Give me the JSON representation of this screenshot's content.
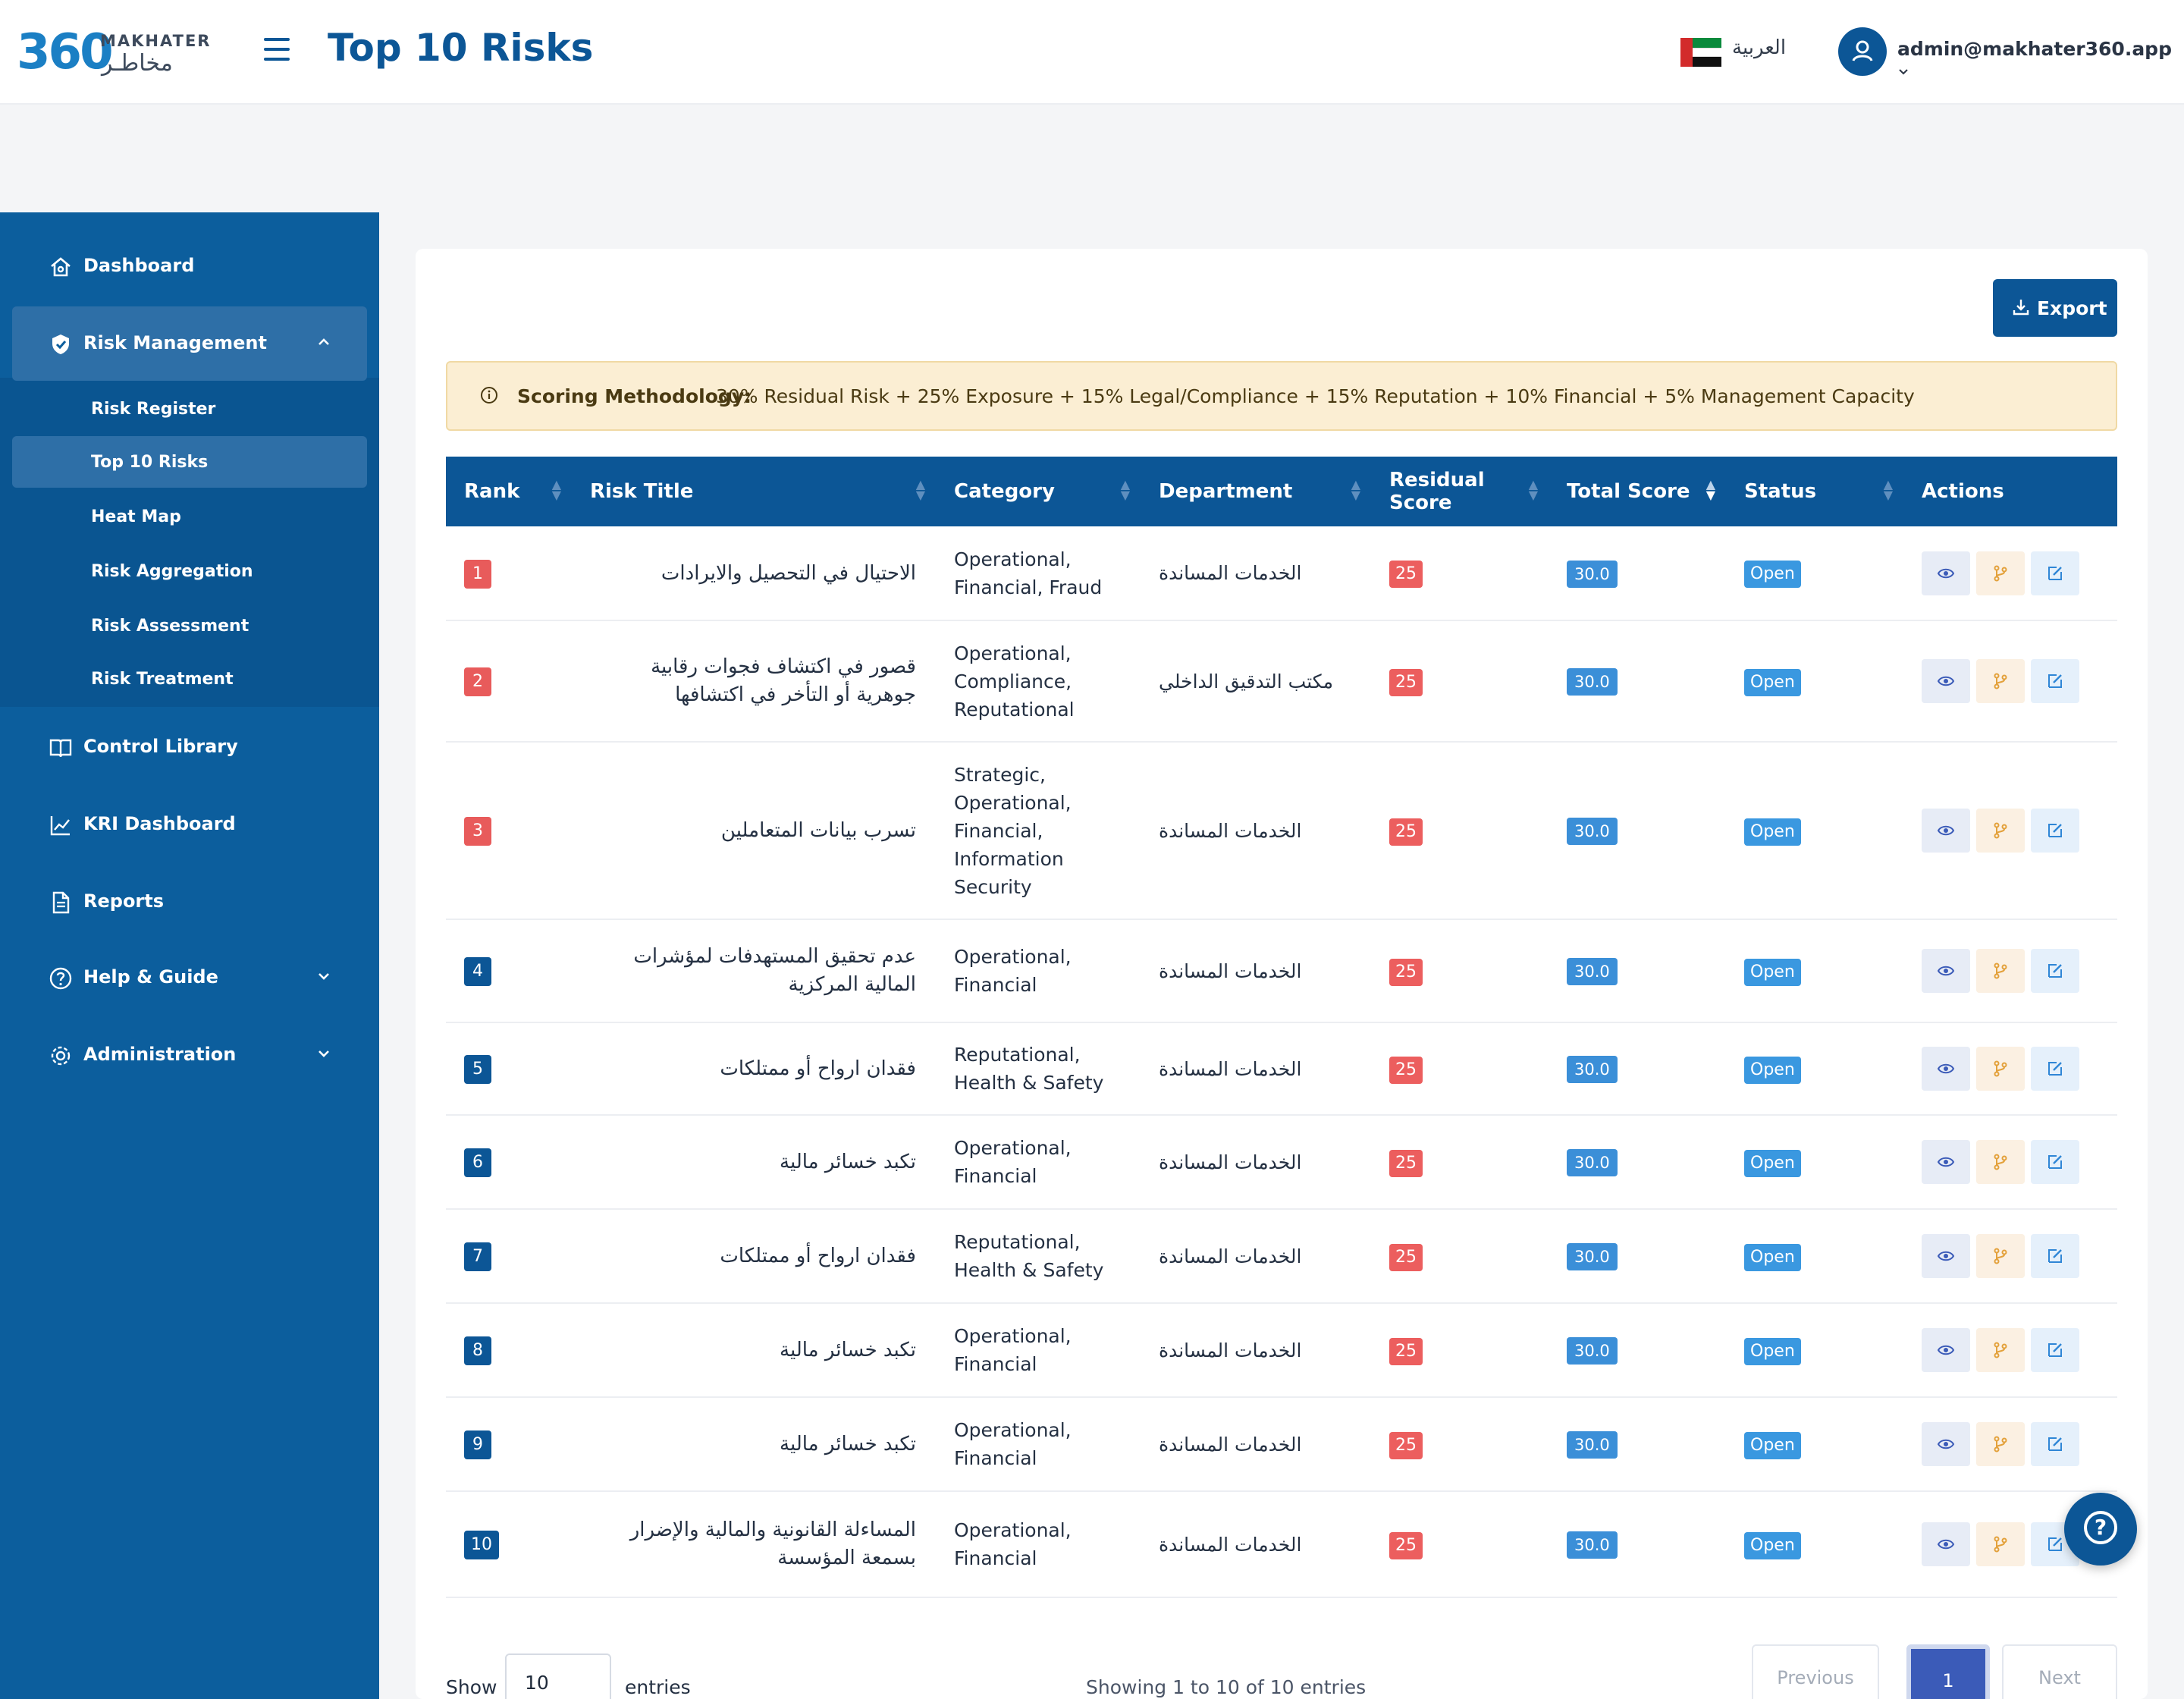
{
  "header": {
    "logo_number": "360",
    "logo_en": "MAKHATER",
    "logo_ar": "مخاطـر",
    "title": "Top 10 Risks",
    "language": "العربية",
    "user_email": "admin@makhater360.app"
  },
  "sidebar": {
    "items": [
      {
        "label": "Dashboard",
        "icon": "home-icon"
      },
      {
        "label": "Risk Management",
        "icon": "shield-icon",
        "expanded": true
      },
      {
        "label": "Control Library",
        "icon": "book-icon"
      },
      {
        "label": "KRI Dashboard",
        "icon": "chart-line-icon"
      },
      {
        "label": "Reports",
        "icon": "document-icon"
      },
      {
        "label": "Help & Guide",
        "icon": "help-circle-icon"
      },
      {
        "label": "Administration",
        "icon": "gear-icon"
      }
    ],
    "sub_items": [
      {
        "label": "Risk Register"
      },
      {
        "label": "Top 10 Risks",
        "active": true
      },
      {
        "label": "Heat Map"
      },
      {
        "label": "Risk Aggregation"
      },
      {
        "label": "Risk Assessment"
      },
      {
        "label": "Risk Treatment"
      }
    ]
  },
  "toolbar": {
    "export_label": "Export"
  },
  "notice": {
    "strong": "Scoring Methodology:",
    "text": "30% Residual Risk + 25% Exposure + 15% Legal/Compliance + 15% Reputation + 10% Financial + 5% Management Capacity"
  },
  "table": {
    "columns": [
      "Rank",
      "Risk Title",
      "Category",
      "Department",
      "Residual Score",
      "Total Score",
      "Status",
      "Actions"
    ],
    "rows": [
      {
        "rank": "1",
        "title": "الاحتيال في التحصيل والايرادات",
        "category": "Operational, Financial, Fraud",
        "department": "الخدمات المساندة",
        "residual": "25",
        "total": "30.0",
        "status": "Open"
      },
      {
        "rank": "2",
        "title": "قصور في اكتشاف فجوات رقابية جوهرية أو التأخر في اكتشافها",
        "category": "Operational, Compliance, Reputational",
        "department": "مكتب التدقيق الداخلي",
        "residual": "25",
        "total": "30.0",
        "status": "Open"
      },
      {
        "rank": "3",
        "title": "تسرب بيانات المتعاملين",
        "category": "Strategic, Operational, Financial, Information Security",
        "department": "الخدمات المساندة",
        "residual": "25",
        "total": "30.0",
        "status": "Open"
      },
      {
        "rank": "4",
        "title": "عدم تحقيق المستهدفات لمؤشرات المالية المركزية",
        "category": "Operational, Financial",
        "department": "الخدمات المساندة",
        "residual": "25",
        "total": "30.0",
        "status": "Open"
      },
      {
        "rank": "5",
        "title": "فقدان ارواح أو ممتلكات",
        "category": "Reputational, Health & Safety",
        "department": "الخدمات المساندة",
        "residual": "25",
        "total": "30.0",
        "status": "Open"
      },
      {
        "rank": "6",
        "title": "تكبد خسائر مالية",
        "category": "Operational, Financial",
        "department": "الخدمات المساندة",
        "residual": "25",
        "total": "30.0",
        "status": "Open"
      },
      {
        "rank": "7",
        "title": "فقدان ارواح أو ممتلكات",
        "category": "Reputational, Health & Safety",
        "department": "الخدمات المساندة",
        "residual": "25",
        "total": "30.0",
        "status": "Open"
      },
      {
        "rank": "8",
        "title": "تكبد خسائر مالية",
        "category": "Operational, Financial",
        "department": "الخدمات المساندة",
        "residual": "25",
        "total": "30.0",
        "status": "Open"
      },
      {
        "rank": "9",
        "title": "تكبد خسائر مالية",
        "category": "Operational, Financial",
        "department": "الخدمات المساندة",
        "residual": "25",
        "total": "30.0",
        "status": "Open"
      },
      {
        "rank": "10",
        "title": "المساءلة القانونية والمالية والإضرار بسمعة المؤسسة",
        "category": "Operational, Financial",
        "department": "الخدمات المساندة",
        "residual": "25",
        "total": "30.0",
        "status": "Open"
      }
    ]
  },
  "footer": {
    "show_label": "Show",
    "page_size": "10",
    "entries_label": "entries",
    "info": "Showing 1 to 10 of 10 entries",
    "previous": "Previous",
    "current_page": "1",
    "next": "Next"
  }
}
